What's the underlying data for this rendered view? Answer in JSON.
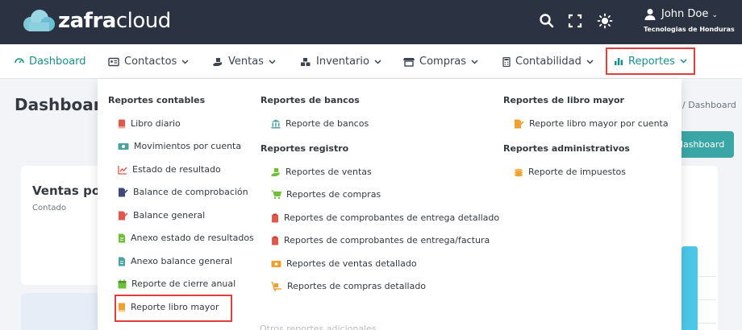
{
  "app": {
    "logo_bold": "zafra",
    "logo_light": "cloud"
  },
  "user": {
    "name": "John Doe",
    "org": "Tecnologias de Honduras"
  },
  "nav": {
    "dashboard": "Dashboard",
    "contactos": "Contactos",
    "ventas": "Ventas",
    "inventario": "Inventario",
    "compras": "Compras",
    "contabilidad": "Contabilidad",
    "reportes": "Reportes"
  },
  "page": {
    "title": "Dashboard",
    "crumb": "/ Dashboard",
    "dash_button": "dashboard",
    "card_title": "Ventas po",
    "card_sub": "Contado"
  },
  "menu": {
    "contables": {
      "heading": "Reportes contables",
      "items": [
        "Libro diario",
        "Movimientos por cuenta",
        "Estado de resultado",
        "Balance de comprobación",
        "Balance general",
        "Anexo estado de resultados",
        "Anexo balance general",
        "Reporte de cierre anual",
        "Reporte libro mayor"
      ]
    },
    "bancos": {
      "heading": "Reportes de bancos",
      "items": [
        "Reporte de bancos"
      ]
    },
    "registro": {
      "heading": "Reportes registro",
      "items": [
        "Reportes de ventas",
        "Reportes de compras",
        "Reportes de comprobantes de entrega detallado",
        "Reportes de comprobantes de entrega/factura",
        "Reportes de ventas detallado",
        "Reportes de compras detallado"
      ]
    },
    "libro_mayor": {
      "heading": "Reportes de libro mayor",
      "items": [
        "Reporte libro mayor por cuenta"
      ]
    },
    "administrativos": {
      "heading": "Reportes administrativos",
      "items": [
        "Reporte de impuestos"
      ]
    },
    "cut_off": "Otros reportes adicionales"
  },
  "colors": {
    "topbar": "#2b3241",
    "accent": "#1a8f8a",
    "highlight": "#e0403b"
  }
}
